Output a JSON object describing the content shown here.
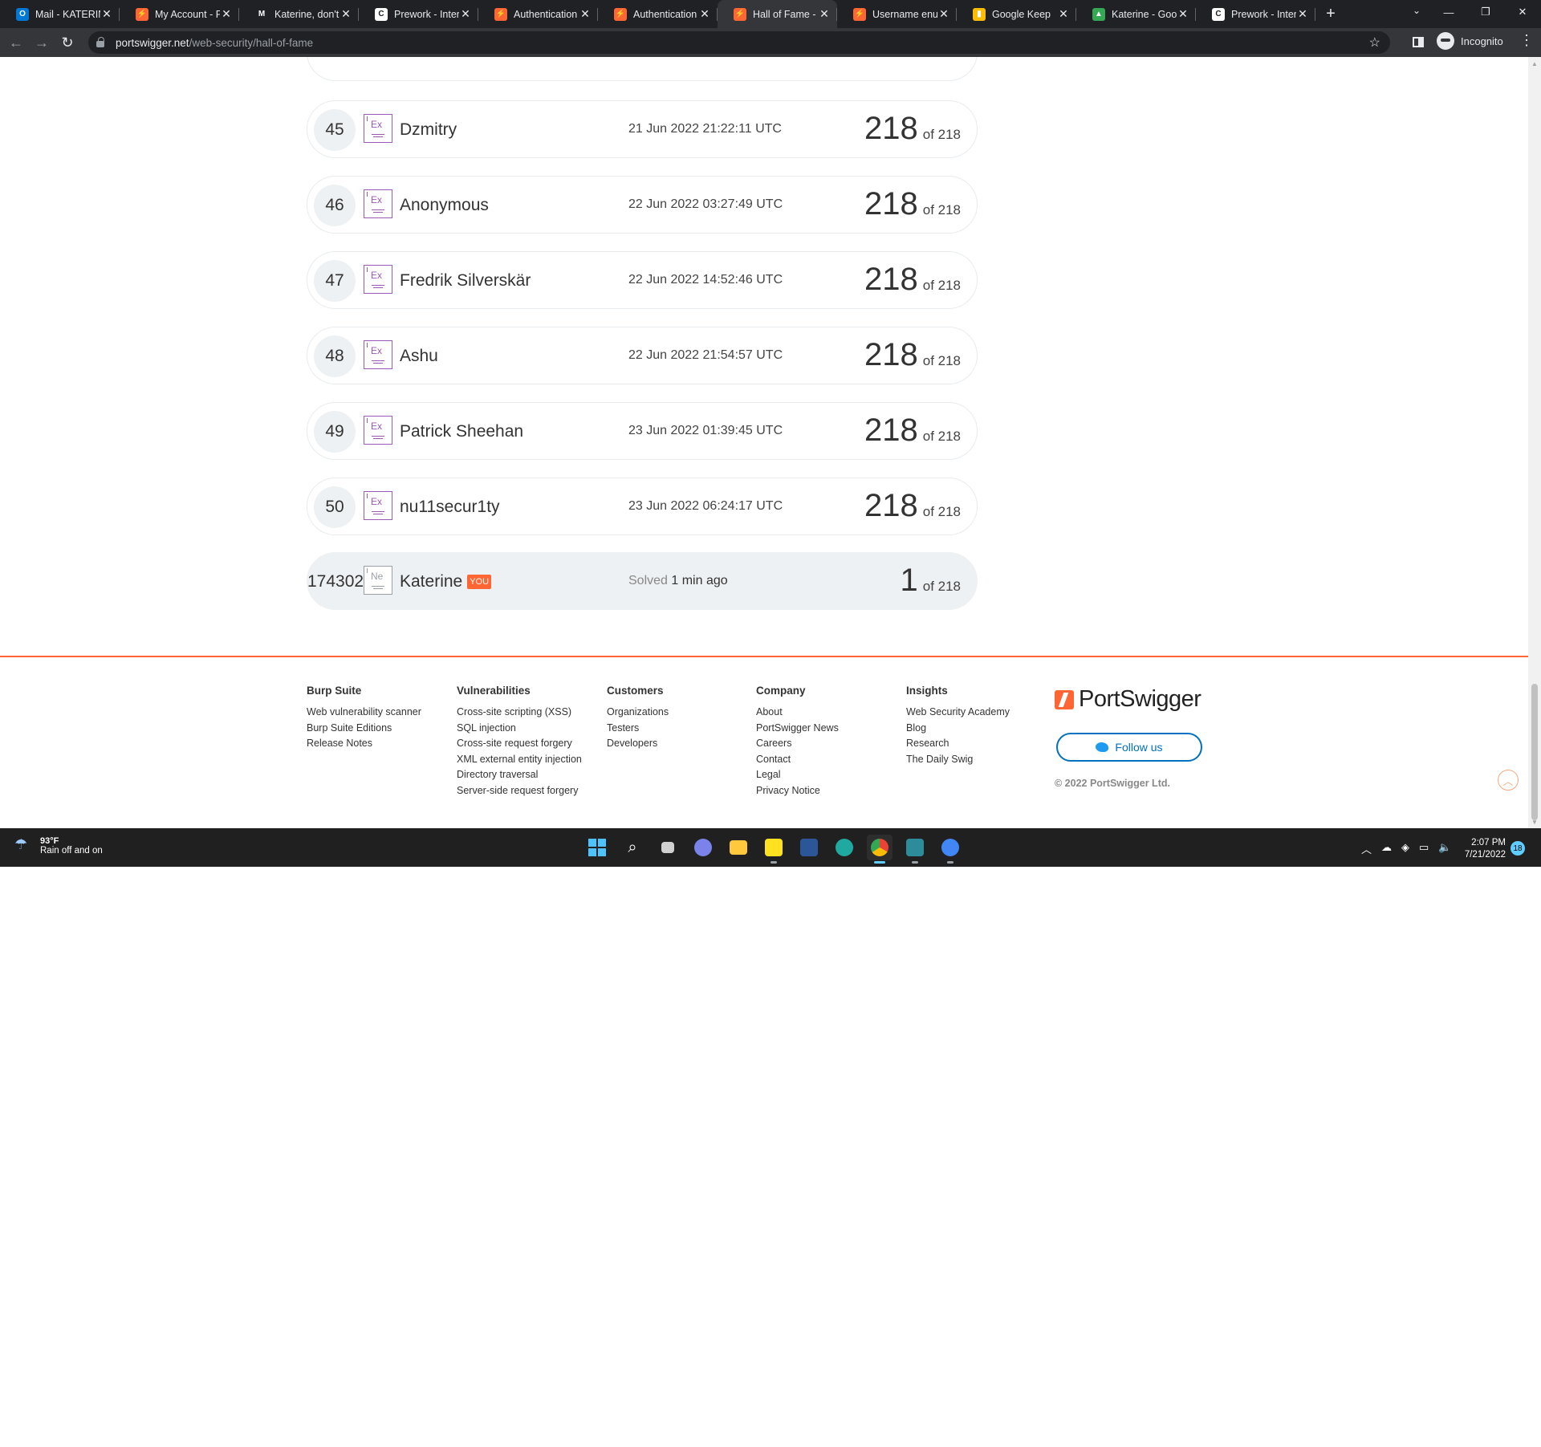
{
  "browser": {
    "tabs": [
      {
        "title": "Mail - KATERINE",
        "color": "#0078d4",
        "glyph": "O"
      },
      {
        "title": "My Account - P",
        "color": "#ff6633",
        "glyph": "⚡"
      },
      {
        "title": "Katerine, don't",
        "color": "#202124",
        "glyph": "M"
      },
      {
        "title": "Prework - Intern",
        "color": "#ffffff",
        "glyph": "C"
      },
      {
        "title": "Authentication",
        "color": "#ff6633",
        "glyph": "⚡"
      },
      {
        "title": "Authentication",
        "color": "#ff6633",
        "glyph": "⚡"
      },
      {
        "title": "Hall of Fame - W",
        "color": "#ff6633",
        "glyph": "⚡"
      },
      {
        "title": "Username enum",
        "color": "#ff6633",
        "glyph": "⚡"
      },
      {
        "title": "Google Keep",
        "color": "#fbbc04",
        "glyph": "▮"
      },
      {
        "title": "Katerine - Goog",
        "color": "#34a853",
        "glyph": "▲"
      },
      {
        "title": "Prework - Intern",
        "color": "#ffffff",
        "glyph": "C"
      }
    ],
    "active_tab_index": 6,
    "url_host": "portswigger.net",
    "url_path": "/web-security/hall-of-fame",
    "profile_label": "Incognito"
  },
  "leaderboard": {
    "rows": [
      {
        "rank": "45",
        "badge": "Ex",
        "name": "Dzmitry",
        "date": "21 Jun 2022 21:22:11 UTC",
        "score": "218",
        "of": "of 218"
      },
      {
        "rank": "46",
        "badge": "Ex",
        "name": "Anonymous",
        "date": "22 Jun 2022 03:27:49 UTC",
        "score": "218",
        "of": "of 218"
      },
      {
        "rank": "47",
        "badge": "Ex",
        "name": "Fredrik Silverskär",
        "date": "22 Jun 2022 14:52:46 UTC",
        "score": "218",
        "of": "of 218"
      },
      {
        "rank": "48",
        "badge": "Ex",
        "name": "Ashu",
        "date": "22 Jun 2022 21:54:57 UTC",
        "score": "218",
        "of": "of 218"
      },
      {
        "rank": "49",
        "badge": "Ex",
        "name": "Patrick Sheehan",
        "date": "23 Jun 2022 01:39:45 UTC",
        "score": "218",
        "of": "of 218"
      },
      {
        "rank": "50",
        "badge": "Ex",
        "name": "nu11secur1ty",
        "date": "23 Jun 2022 06:24:17 UTC",
        "score": "218",
        "of": "of 218"
      }
    ],
    "me": {
      "rank": "174302",
      "badge": "Ne",
      "name": "Katerine",
      "you_label": "YOU",
      "solved_label": "Solved",
      "solved_ago": "1 min ago",
      "score": "1",
      "of": "of 218"
    }
  },
  "footer": {
    "columns": [
      {
        "title": "Burp Suite",
        "links": [
          "Web vulnerability scanner",
          "Burp Suite Editions",
          "Release Notes"
        ]
      },
      {
        "title": "Vulnerabilities",
        "links": [
          "Cross-site scripting (XSS)",
          "SQL injection",
          "Cross-site request forgery",
          "XML external entity injection",
          "Directory traversal",
          "Server-side request forgery"
        ]
      },
      {
        "title": "Customers",
        "links": [
          "Organizations",
          "Testers",
          "Developers"
        ]
      },
      {
        "title": "Company",
        "links": [
          "About",
          "PortSwigger News",
          "Careers",
          "Contact",
          "Legal",
          "Privacy Notice"
        ]
      },
      {
        "title": "Insights",
        "links": [
          "Web Security Academy",
          "Blog",
          "Research",
          "The Daily Swig"
        ]
      }
    ],
    "logo_text": "PortSwigger",
    "follow_label": "Follow us",
    "copyright": "© 2022 PortSwigger Ltd."
  },
  "taskbar": {
    "temp": "93°F",
    "weather": "Rain off and on",
    "time": "2:07 PM",
    "date": "7/21/2022",
    "notifications": "18"
  }
}
